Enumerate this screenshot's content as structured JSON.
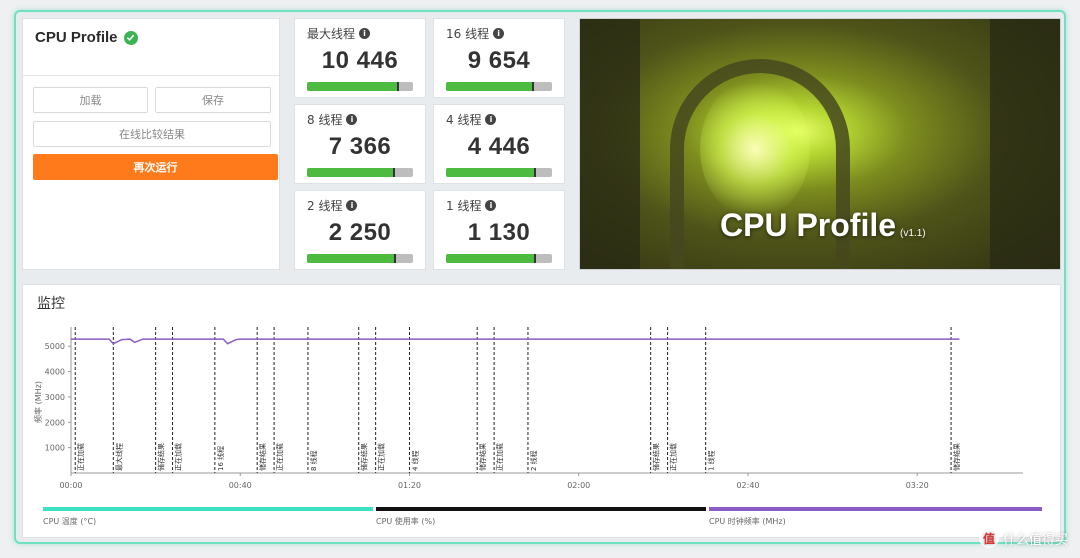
{
  "left_panel": {
    "title": "CPU Profile",
    "buttons": {
      "load": "加载",
      "save": "保存",
      "compare": "在线比较结果",
      "run": "再次运行"
    }
  },
  "tiles": [
    {
      "label": "最大线程",
      "value": "10 446",
      "fill": 0.86
    },
    {
      "label": "16 线程",
      "value": "9 654",
      "fill": 0.82
    },
    {
      "label": "8 线程",
      "value": "7 366",
      "fill": 0.82
    },
    {
      "label": "4 线程",
      "value": "4 446",
      "fill": 0.84
    },
    {
      "label": "2 线程",
      "value": "2 250",
      "fill": 0.83
    },
    {
      "label": "1 线程",
      "value": "1 130",
      "fill": 0.84
    }
  ],
  "hero": {
    "title": "CPU Profile",
    "version": "(v1.1)"
  },
  "monitor": {
    "title": "监控",
    "legend": [
      {
        "label": "CPU 温度 (°C)",
        "color": "#3de0c0"
      },
      {
        "label": "CPU 使用率 (%)",
        "color": "#111111"
      },
      {
        "label": "CPU 时钟频率 (MHz)",
        "color": "#8a5cc4"
      }
    ]
  },
  "chart_data": {
    "type": "line",
    "ylabel": "频率 (MHz)",
    "yticks": [
      1000,
      2000,
      3000,
      4000,
      5000
    ],
    "ylim": [
      0,
      5600
    ],
    "xlim": [
      0,
      225
    ],
    "xticks": [
      {
        "t": 0,
        "label": "00:00"
      },
      {
        "t": 40,
        "label": "00:40"
      },
      {
        "t": 80,
        "label": "01:20"
      },
      {
        "t": 120,
        "label": "02:00"
      },
      {
        "t": 160,
        "label": "02:40"
      },
      {
        "t": 200,
        "label": "03:20"
      }
    ],
    "series": [
      {
        "name": "CPU 时钟频率 (MHz)",
        "color": "#8a5cc4",
        "points": [
          [
            0,
            5280
          ],
          [
            9,
            5280
          ],
          [
            10,
            5100
          ],
          [
            12,
            5260
          ],
          [
            14,
            5280
          ],
          [
            15,
            5150
          ],
          [
            17,
            5280
          ],
          [
            30,
            5280
          ],
          [
            36,
            5280
          ],
          [
            37,
            5100
          ],
          [
            39,
            5260
          ],
          [
            40,
            5280
          ],
          [
            210,
            5280
          ]
        ]
      }
    ],
    "events": [
      {
        "t": 1,
        "label": "正在加载"
      },
      {
        "t": 10,
        "label": "最大线程"
      },
      {
        "t": 20,
        "label": "储存结果"
      },
      {
        "t": 24,
        "label": "正在加载"
      },
      {
        "t": 34,
        "label": "16 线程"
      },
      {
        "t": 44,
        "label": "储存结果"
      },
      {
        "t": 48,
        "label": "正在加载"
      },
      {
        "t": 56,
        "label": "8 线程"
      },
      {
        "t": 68,
        "label": "储存结果"
      },
      {
        "t": 72,
        "label": "正在加载"
      },
      {
        "t": 80,
        "label": "4 线程"
      },
      {
        "t": 96,
        "label": "储存结果"
      },
      {
        "t": 100,
        "label": "正在加载"
      },
      {
        "t": 108,
        "label": "2 线程"
      },
      {
        "t": 137,
        "label": "储存结果"
      },
      {
        "t": 141,
        "label": "正在加载"
      },
      {
        "t": 150,
        "label": "1 线程"
      },
      {
        "t": 208,
        "label": "储存结果"
      }
    ]
  },
  "watermark": {
    "icon": "值",
    "text": "什么值得买"
  }
}
